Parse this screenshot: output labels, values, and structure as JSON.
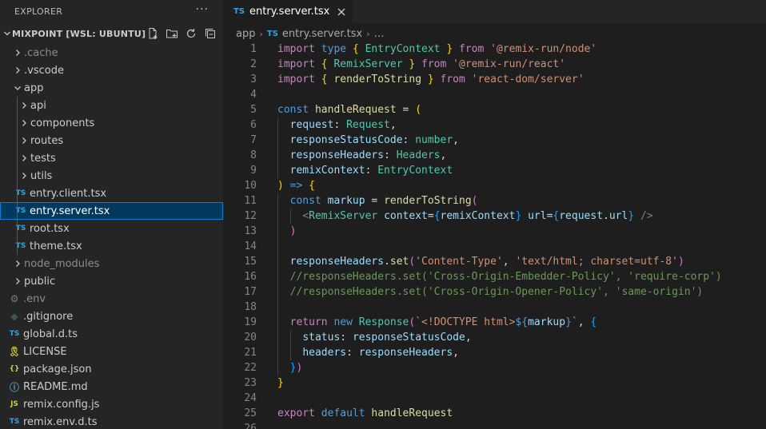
{
  "explorer": {
    "title": "EXPLORER",
    "more": "···",
    "section": "MIXPOINT [WSL: UBUNTU]",
    "items": [
      {
        "label": ".cache",
        "depth": 0,
        "kind": "folder",
        "open": false,
        "dim": true
      },
      {
        "label": ".vscode",
        "depth": 0,
        "kind": "folder",
        "open": false
      },
      {
        "label": "app",
        "depth": 0,
        "kind": "folder",
        "open": true
      },
      {
        "label": "api",
        "depth": 1,
        "kind": "folder",
        "open": false
      },
      {
        "label": "components",
        "depth": 1,
        "kind": "folder",
        "open": false
      },
      {
        "label": "routes",
        "depth": 1,
        "kind": "folder",
        "open": false
      },
      {
        "label": "tests",
        "depth": 1,
        "kind": "folder",
        "open": false
      },
      {
        "label": "utils",
        "depth": 1,
        "kind": "folder",
        "open": false
      },
      {
        "label": "entry.client.tsx",
        "depth": 1,
        "kind": "ts"
      },
      {
        "label": "entry.server.tsx",
        "depth": 1,
        "kind": "ts",
        "selected": true
      },
      {
        "label": "root.tsx",
        "depth": 1,
        "kind": "ts"
      },
      {
        "label": "theme.tsx",
        "depth": 1,
        "kind": "ts"
      },
      {
        "label": "node_modules",
        "depth": 0,
        "kind": "folder",
        "open": false,
        "dim": true
      },
      {
        "label": "public",
        "depth": 0,
        "kind": "folder",
        "open": false
      },
      {
        "label": ".env",
        "depth": 0,
        "kind": "gear",
        "dim": true
      },
      {
        "label": ".gitignore",
        "depth": 0,
        "kind": "git"
      },
      {
        "label": "global.d.ts",
        "depth": 0,
        "kind": "ts"
      },
      {
        "label": "LICENSE",
        "depth": 0,
        "kind": "license"
      },
      {
        "label": "package.json",
        "depth": 0,
        "kind": "json"
      },
      {
        "label": "README.md",
        "depth": 0,
        "kind": "info"
      },
      {
        "label": "remix.config.js",
        "depth": 0,
        "kind": "js"
      },
      {
        "label": "remix.env.d.ts",
        "depth": 0,
        "kind": "ts"
      }
    ]
  },
  "icons": {
    "ts": "TS",
    "js": "JS",
    "json": "{}",
    "gear": "⚙",
    "git": "◆",
    "license": "🎗",
    "info": "ⓘ"
  },
  "tab": {
    "badge": "TS",
    "label": "entry.server.tsx"
  },
  "breadcrumb": {
    "folder": "app",
    "badge": "TS",
    "file": "entry.server.tsx",
    "more": "…"
  },
  "colors": {
    "selection": "#04395e",
    "focus_border": "#007fd4",
    "ts_icon": "#3c9fd6",
    "js_icon": "#cbcb41"
  },
  "code": {
    "lines": [
      {
        "n": "1",
        "tokens": [
          [
            "k",
            "import"
          ],
          [
            "p",
            " "
          ],
          [
            "kb",
            "type"
          ],
          [
            "p",
            " "
          ],
          [
            "b1",
            "{"
          ],
          [
            "p",
            " "
          ],
          [
            "t",
            "EntryContext"
          ],
          [
            "p",
            " "
          ],
          [
            "b1",
            "}"
          ],
          [
            "p",
            " "
          ],
          [
            "k",
            "from"
          ],
          [
            "p",
            " "
          ],
          [
            "s",
            "'@remix-run/node'"
          ]
        ]
      },
      {
        "n": "2",
        "tokens": [
          [
            "k",
            "import"
          ],
          [
            "p",
            " "
          ],
          [
            "b1",
            "{"
          ],
          [
            "p",
            " "
          ],
          [
            "t",
            "RemixServer"
          ],
          [
            "p",
            " "
          ],
          [
            "b1",
            "}"
          ],
          [
            "p",
            " "
          ],
          [
            "k",
            "from"
          ],
          [
            "p",
            " "
          ],
          [
            "s",
            "'@remix-run/react'"
          ]
        ]
      },
      {
        "n": "3",
        "tokens": [
          [
            "k",
            "import"
          ],
          [
            "p",
            " "
          ],
          [
            "b1",
            "{"
          ],
          [
            "p",
            " "
          ],
          [
            "f",
            "renderToString"
          ],
          [
            "p",
            " "
          ],
          [
            "b1",
            "}"
          ],
          [
            "p",
            " "
          ],
          [
            "k",
            "from"
          ],
          [
            "p",
            " "
          ],
          [
            "s",
            "'react-dom/server'"
          ]
        ]
      },
      {
        "n": "4",
        "tokens": []
      },
      {
        "n": "5",
        "tokens": [
          [
            "kb",
            "const"
          ],
          [
            "p",
            " "
          ],
          [
            "f",
            "handleRequest"
          ],
          [
            "p",
            " = "
          ],
          [
            "b1",
            "("
          ]
        ]
      },
      {
        "n": "6",
        "indent": 1,
        "tokens": [
          [
            "p",
            "  "
          ],
          [
            "v",
            "request"
          ],
          [
            "p",
            ": "
          ],
          [
            "t",
            "Request"
          ],
          [
            "p",
            ","
          ]
        ]
      },
      {
        "n": "7",
        "indent": 1,
        "tokens": [
          [
            "p",
            "  "
          ],
          [
            "v",
            "responseStatusCode"
          ],
          [
            "p",
            ": "
          ],
          [
            "t",
            "number"
          ],
          [
            "p",
            ","
          ]
        ]
      },
      {
        "n": "8",
        "indent": 1,
        "tokens": [
          [
            "p",
            "  "
          ],
          [
            "v",
            "responseHeaders"
          ],
          [
            "p",
            ": "
          ],
          [
            "t",
            "Headers"
          ],
          [
            "p",
            ","
          ]
        ]
      },
      {
        "n": "9",
        "indent": 1,
        "tokens": [
          [
            "p",
            "  "
          ],
          [
            "v",
            "remixContext"
          ],
          [
            "p",
            ": "
          ],
          [
            "t",
            "EntryContext"
          ]
        ]
      },
      {
        "n": "10",
        "tokens": [
          [
            "b1",
            ")"
          ],
          [
            "p",
            " "
          ],
          [
            "kb",
            "=>"
          ],
          [
            "p",
            " "
          ],
          [
            "b1",
            "{"
          ]
        ]
      },
      {
        "n": "11",
        "indent": 1,
        "tokens": [
          [
            "p",
            "  "
          ],
          [
            "kb",
            "const"
          ],
          [
            "p",
            " "
          ],
          [
            "v",
            "markup"
          ],
          [
            "p",
            " = "
          ],
          [
            "f",
            "renderToString"
          ],
          [
            "b2",
            "("
          ]
        ]
      },
      {
        "n": "12",
        "indent": 2,
        "tokens": [
          [
            "p",
            "    "
          ],
          [
            "tg",
            "<"
          ],
          [
            "t",
            "RemixServer"
          ],
          [
            "p",
            " "
          ],
          [
            "v",
            "context"
          ],
          [
            "p",
            "="
          ],
          [
            "b3",
            "{"
          ],
          [
            "v",
            "remixContext"
          ],
          [
            "b3",
            "}"
          ],
          [
            "p",
            " "
          ],
          [
            "v",
            "url"
          ],
          [
            "p",
            "="
          ],
          [
            "b3",
            "{"
          ],
          [
            "v",
            "request"
          ],
          [
            "p",
            "."
          ],
          [
            "v",
            "url"
          ],
          [
            "b3",
            "}"
          ],
          [
            "p",
            " "
          ],
          [
            "tg",
            "/>"
          ]
        ]
      },
      {
        "n": "13",
        "indent": 1,
        "tokens": [
          [
            "p",
            "  "
          ],
          [
            "b2",
            ")"
          ]
        ]
      },
      {
        "n": "14",
        "indent": 1,
        "tokens": []
      },
      {
        "n": "15",
        "indent": 1,
        "tokens": [
          [
            "p",
            "  "
          ],
          [
            "v",
            "responseHeaders"
          ],
          [
            "p",
            "."
          ],
          [
            "f",
            "set"
          ],
          [
            "b2",
            "("
          ],
          [
            "s",
            "'Content-Type'"
          ],
          [
            "p",
            ", "
          ],
          [
            "s",
            "'text/html; charset=utf-8'"
          ],
          [
            "b2",
            ")"
          ]
        ]
      },
      {
        "n": "16",
        "indent": 1,
        "tokens": [
          [
            "p",
            "  "
          ],
          [
            "c",
            "//responseHeaders.set('Cross-Origin-Embedder-Policy', 'require-corp')"
          ]
        ]
      },
      {
        "n": "17",
        "indent": 1,
        "tokens": [
          [
            "p",
            "  "
          ],
          [
            "c",
            "//responseHeaders.set('Cross-Origin-Opener-Policy', 'same-origin')"
          ]
        ]
      },
      {
        "n": "18",
        "indent": 1,
        "tokens": []
      },
      {
        "n": "19",
        "indent": 1,
        "tokens": [
          [
            "p",
            "  "
          ],
          [
            "k",
            "return"
          ],
          [
            "p",
            " "
          ],
          [
            "kb",
            "new"
          ],
          [
            "p",
            " "
          ],
          [
            "t",
            "Response"
          ],
          [
            "b2",
            "("
          ],
          [
            "s",
            "`<!DOCTYPE html>"
          ],
          [
            "kb",
            "${"
          ],
          [
            "v",
            "markup"
          ],
          [
            "kb",
            "}"
          ],
          [
            "s",
            "`"
          ],
          [
            "p",
            ", "
          ],
          [
            "b3",
            "{"
          ]
        ]
      },
      {
        "n": "20",
        "indent": 2,
        "tokens": [
          [
            "p",
            "    "
          ],
          [
            "v",
            "status"
          ],
          [
            "p",
            ": "
          ],
          [
            "v",
            "responseStatusCode"
          ],
          [
            "p",
            ","
          ]
        ]
      },
      {
        "n": "21",
        "indent": 2,
        "tokens": [
          [
            "p",
            "    "
          ],
          [
            "v",
            "headers"
          ],
          [
            "p",
            ": "
          ],
          [
            "v",
            "responseHeaders"
          ],
          [
            "p",
            ","
          ]
        ]
      },
      {
        "n": "22",
        "indent": 1,
        "tokens": [
          [
            "p",
            "  "
          ],
          [
            "b3",
            "}"
          ],
          [
            "b2",
            ")"
          ]
        ]
      },
      {
        "n": "23",
        "tokens": [
          [
            "b1",
            "}"
          ]
        ]
      },
      {
        "n": "24",
        "tokens": []
      },
      {
        "n": "25",
        "tokens": [
          [
            "k",
            "export"
          ],
          [
            "p",
            " "
          ],
          [
            "kb",
            "default"
          ],
          [
            "p",
            " "
          ],
          [
            "f",
            "handleRequest"
          ]
        ]
      },
      {
        "n": "26",
        "tokens": []
      }
    ]
  }
}
